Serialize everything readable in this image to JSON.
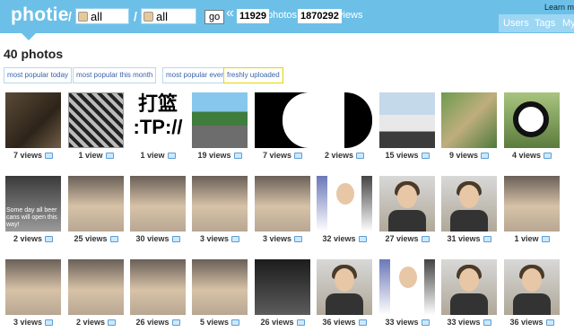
{
  "header": {
    "logo": "photie",
    "sep1": "/",
    "user_filter": "all",
    "sep2": "/",
    "tag_filter": "all",
    "go_label": "go",
    "raquo": "«",
    "photo_count": "11929",
    "photos_label": "photos,",
    "view_count": "1870292",
    "views_label": "views",
    "learn_more": "Learn mo",
    "nav": {
      "users": "Users",
      "tags": "Tags",
      "my": "My"
    }
  },
  "page_title": "40 photos",
  "tabs": [
    {
      "label": "most popular today",
      "active": false
    },
    {
      "label": "most popular this month",
      "active": false
    },
    {
      "label": "most popular ever",
      "active": false
    },
    {
      "label": "freshly uploaded",
      "active": true
    }
  ],
  "rows": [
    [
      {
        "views": "7 views",
        "kind": "dark"
      },
      {
        "views": "1 view",
        "kind": "collage"
      },
      {
        "views": "1 view",
        "kind": "text",
        "text": "打篮\n:TP://"
      },
      {
        "views": "19 views",
        "kind": "game"
      },
      {
        "views": "7 views",
        "kind": "card"
      },
      {
        "views": "2 views",
        "kind": "card2"
      },
      {
        "views": "15 views",
        "kind": "car"
      },
      {
        "views": "9 views",
        "kind": "nature"
      },
      {
        "views": "4 views",
        "kind": "panda"
      }
    ],
    [
      {
        "views": "2 views",
        "kind": "bw",
        "text": "Some day all beer cans will open this way!"
      },
      {
        "views": "25 views",
        "kind": "group"
      },
      {
        "views": "30 views",
        "kind": "group"
      },
      {
        "views": "3 views",
        "kind": "group"
      },
      {
        "views": "3 views",
        "kind": "group"
      },
      {
        "views": "32 views",
        "kind": "anime"
      },
      {
        "views": "27 views",
        "kind": "person"
      },
      {
        "views": "31 views",
        "kind": "person"
      },
      {
        "views": "1 view",
        "kind": "group"
      }
    ],
    [
      {
        "views": "3 views",
        "kind": "group"
      },
      {
        "views": "2 views",
        "kind": "group"
      },
      {
        "views": "26 views",
        "kind": "group"
      },
      {
        "views": "5 views",
        "kind": "group"
      },
      {
        "views": "26 views",
        "kind": "crowd"
      },
      {
        "views": "36 views",
        "kind": "person"
      },
      {
        "views": "33 views",
        "kind": "anime"
      },
      {
        "views": "33 views",
        "kind": "person"
      },
      {
        "views": "36 views",
        "kind": "person"
      }
    ]
  ],
  "colors": {
    "header_bg": "#6cc0e8",
    "link": "#3b63a8",
    "active_tab_border": "#e6d300"
  }
}
